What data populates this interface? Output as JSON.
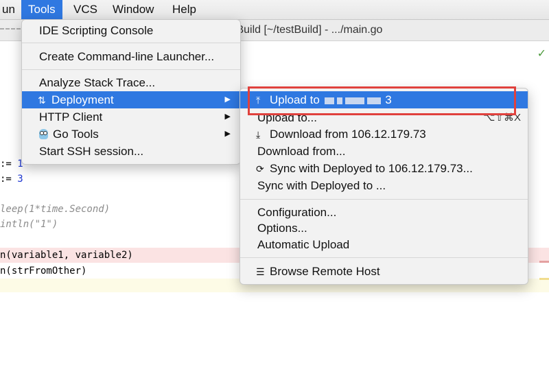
{
  "menubar": {
    "items": [
      "un",
      "Tools",
      "VCS",
      "Window",
      "Help"
    ],
    "active": "Tools"
  },
  "window": {
    "title": "tBuild [~/testBuild] - .../main.go"
  },
  "editor": {
    "lines": [
      {
        "pre": ":= ",
        "num": "1"
      },
      {
        "pre": ":= ",
        "num": "3"
      },
      {
        "comment": "leep(1*time.Second)"
      },
      {
        "comment": "intln(\"1\")"
      },
      {
        "text": "n(variable1, variable2)"
      },
      {
        "text": "n(strFromOther)"
      }
    ],
    "status_check": "✓"
  },
  "tools_menu": {
    "items": [
      {
        "label": "IDE Scripting Console"
      },
      {
        "label": "Create Command-line Launcher..."
      },
      {
        "label": "Analyze Stack Trace..."
      },
      {
        "label": "Deployment",
        "icon": "deployment-icon",
        "icon_glyph": "⇅",
        "submenu": "▶"
      },
      {
        "label": "HTTP Client",
        "submenu": "▶"
      },
      {
        "label": "Go Tools",
        "icon": "gopher-icon",
        "submenu": "▶"
      },
      {
        "label": "Start SSH session..."
      }
    ]
  },
  "deployment_menu": {
    "items": [
      {
        "label": "Upload to ",
        "suffix": "3",
        "icon": "upload-icon",
        "icon_glyph": "⤒"
      },
      {
        "label": "Upload to...",
        "shortcut": "⌥⇧⌘X"
      },
      {
        "label": "Download from 106.12.179.73",
        "icon": "download-icon",
        "icon_glyph": "⤓"
      },
      {
        "label": "Download from..."
      },
      {
        "label": "Sync with Deployed to 106.12.179.73...",
        "icon": "sync-icon",
        "icon_glyph": "⟳"
      },
      {
        "label": "Sync with Deployed to ..."
      },
      {
        "label": "Configuration..."
      },
      {
        "label": "Options..."
      },
      {
        "label": "Automatic Upload"
      },
      {
        "label": "Browse Remote Host",
        "icon": "server-icon",
        "icon_glyph": "☰"
      }
    ]
  },
  "colors": {
    "highlight": "#2f78e1",
    "annotation_box": "#e0413d"
  }
}
